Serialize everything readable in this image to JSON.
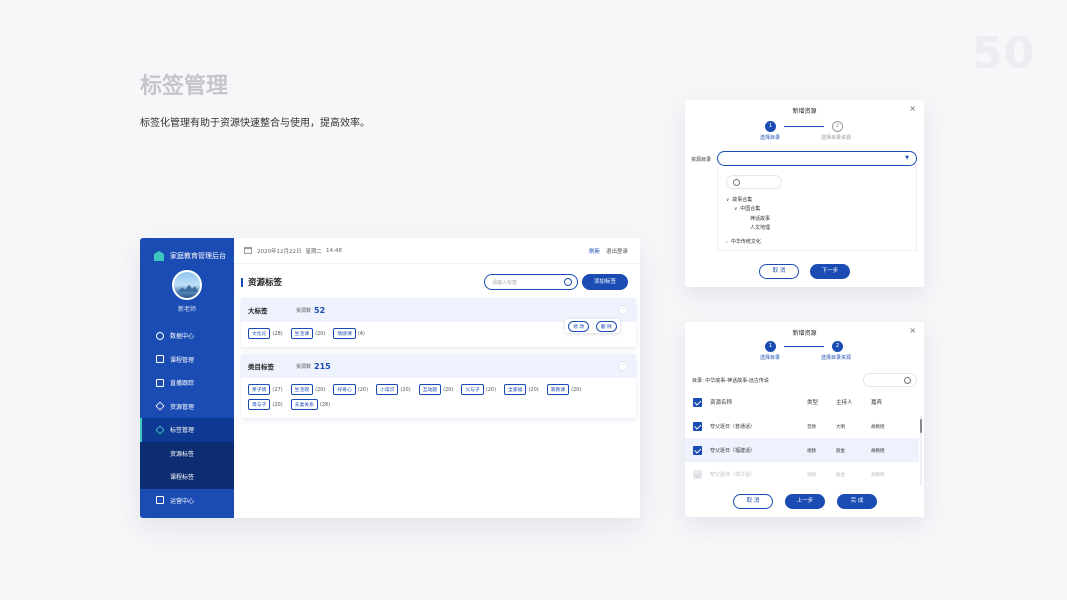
{
  "page": {
    "number": "50",
    "title": "标签管理",
    "subtitle": "标签化管理有助于资源快速整合与使用，提高效率。"
  },
  "app": {
    "brand": "家庭教育管理后台",
    "username": "新老师",
    "menu": [
      {
        "label": "数据中心",
        "icon": "network-icon"
      },
      {
        "label": "课程管理",
        "icon": "book-icon"
      },
      {
        "label": "直播跟踪",
        "icon": "live-icon"
      },
      {
        "label": "资源管理",
        "icon": "layers-icon"
      },
      {
        "label": "标签管理",
        "icon": "tag-icon",
        "active": true
      },
      {
        "label": "资源标签",
        "sub": true
      },
      {
        "label": "课程标签",
        "sub": true
      },
      {
        "label": "运营中心",
        "icon": "monitor-icon"
      }
    ],
    "topbar": {
      "date": "2020年12月22日",
      "weekday": "星期二",
      "time": "14:48",
      "refresh": "刷新",
      "logout": "退出登录"
    },
    "section_title": "资源标签",
    "search_placeholder": "请输入标签",
    "add_button": "添加标签",
    "cards": [
      {
        "title": "大标签",
        "count_label": "资源数",
        "count": "52",
        "tags": [
          {
            "name": "文化论",
            "count": "(28)"
          },
          {
            "name": "生活课",
            "count": "(20)"
          },
          {
            "name": "情感课",
            "count": "(4)"
          }
        ]
      },
      {
        "title": "类目标签",
        "count_label": "资源数",
        "count": "215",
        "tags": [
          {
            "name": "亲子情",
            "count": "(27)"
          },
          {
            "name": "生活观",
            "count": "(20)"
          },
          {
            "name": "好奇心",
            "count": "(20)"
          },
          {
            "name": "小常识",
            "count": "(20)"
          },
          {
            "name": "互动题",
            "count": "(20)"
          },
          {
            "name": "父与子",
            "count": "(20)"
          },
          {
            "name": "全家福",
            "count": "(20)"
          },
          {
            "name": "家教课",
            "count": "(20)"
          },
          {
            "name": "母与子",
            "count": "(20)"
          },
          {
            "name": "夫妻关系",
            "count": "(28)"
          }
        ]
      }
    ],
    "popover": {
      "edit": "修 改",
      "delete": "删 除"
    }
  },
  "dialog1": {
    "title": "新增资源",
    "steps": [
      {
        "num": "1",
        "label": "选择目录"
      },
      {
        "num": "2",
        "label": "选择目录资源"
      }
    ],
    "field_label": "资源目录",
    "tree": [
      {
        "label": "故事合集",
        "level": 0,
        "expanded": true
      },
      {
        "label": "中国合集",
        "level": 1,
        "expanded": true
      },
      {
        "label": "神话故事",
        "level": 2
      },
      {
        "label": "人文地理",
        "level": 2
      },
      {
        "label": "中华传统文化",
        "level": 0,
        "expanded": false
      }
    ],
    "cancel": "取 消",
    "next": "下一步"
  },
  "dialog2": {
    "title": "新增资源",
    "steps": [
      {
        "num": "1",
        "label": "选择目录"
      },
      {
        "num": "2",
        "label": "选择目录资源"
      }
    ],
    "path": "目录: 中华故事-神话故事-远古传说",
    "columns": {
      "name": "资源名称",
      "type": "类型",
      "host": "主持人",
      "guest": "嘉宾"
    },
    "rows": [
      {
        "name": "夸父逐日（普通话）",
        "type": "音频",
        "host": "大明",
        "guest": "胡教授",
        "checked": true
      },
      {
        "name": "夸父逐日（福建话）",
        "type": "视频",
        "host": "丽金",
        "guest": "胡教授",
        "checked": true,
        "highlight": true
      },
      {
        "name": "夸父逐日（浙江话）",
        "type": "视频",
        "host": "丽金",
        "guest": "胡教授",
        "disabled": true
      }
    ],
    "cancel": "取 消",
    "prev": "上一步",
    "done": "完 成"
  }
}
